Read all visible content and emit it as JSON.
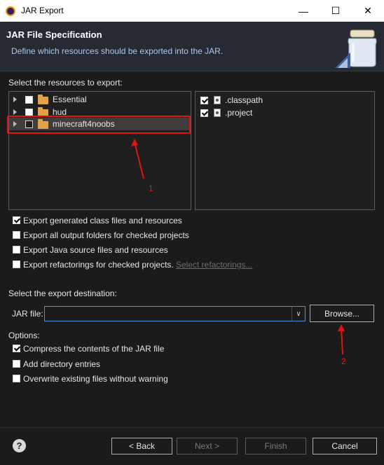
{
  "window": {
    "title": "JAR Export"
  },
  "header": {
    "title": "JAR File Specification",
    "description": "Define which resources should be exported into the JAR."
  },
  "resources": {
    "label": "Select the resources to export:",
    "projects": [
      {
        "name": "Essential",
        "checked": false
      },
      {
        "name": "hud",
        "checked": false
      },
      {
        "name": "minecraft4noobs",
        "checked": false,
        "selected": true
      }
    ],
    "files": [
      {
        "name": ".classpath",
        "checked": true
      },
      {
        "name": ".project",
        "checked": true
      }
    ]
  },
  "annotations": {
    "marker1": "1",
    "marker2": "2"
  },
  "export_options": [
    {
      "label": "Export generated class files and resources",
      "checked": true
    },
    {
      "label": "Export all output folders for checked projects",
      "checked": false
    },
    {
      "label": "Export Java source files and resources",
      "checked": false
    },
    {
      "label": "Export refactorings for checked projects.",
      "checked": false,
      "link": "Select refactorings..."
    }
  ],
  "destination": {
    "label": "Select the export destination:",
    "jar_label": "JAR file:",
    "jar_value": "",
    "browse_label": "Browse..."
  },
  "options": {
    "label": "Options:",
    "items": [
      {
        "label": "Compress the contents of the JAR file",
        "checked": true
      },
      {
        "label": "Add directory entries",
        "checked": false
      },
      {
        "label": "Overwrite existing files without warning",
        "checked": false
      }
    ]
  },
  "footer": {
    "help_icon": "?",
    "back": "< Back",
    "next": "Next >",
    "finish": "Finish",
    "cancel": "Cancel"
  },
  "colors": {
    "annotation": "#e0131b",
    "header_bg": "#262a33",
    "body_bg": "#1b1b1b"
  },
  "icons": [
    "eclipse-icon",
    "minimize-icon",
    "maximize-icon",
    "close-icon",
    "jar-icon",
    "folder-icon",
    "file-icon",
    "help-icon",
    "chevron-down-icon"
  ]
}
